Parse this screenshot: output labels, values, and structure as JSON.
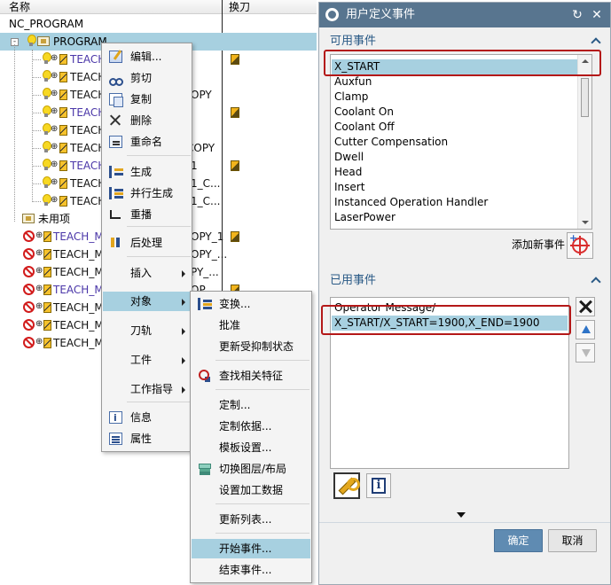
{
  "tree": {
    "headers": {
      "name": "名称",
      "tool_change": "换刀"
    },
    "root": "NC_PROGRAM",
    "program": "PROGRAM",
    "rows": [
      {
        "label": "TEACH",
        "suffix": "",
        "purple": true,
        "toolchange": true
      },
      {
        "label": "TEACH",
        "suffix": "",
        "purple": false,
        "toolchange": false
      },
      {
        "label": "TEACH",
        "suffix": "OPY",
        "purple": false,
        "toolchange": false
      },
      {
        "label": "TEACH",
        "suffix": "",
        "purple": true,
        "toolchange": true
      },
      {
        "label": "TEACH",
        "suffix": "",
        "purple": false,
        "toolchange": false
      },
      {
        "label": "TEACH",
        "suffix": "COPY",
        "purple": false,
        "toolchange": false
      },
      {
        "label": "TEACH",
        "suffix": "1",
        "purple": true,
        "toolchange": true
      },
      {
        "label": "TEACH",
        "suffix": "1_C...",
        "purple": false,
        "toolchange": false
      },
      {
        "label": "TEACH",
        "suffix": "1_C...",
        "purple": false,
        "toolchange": false
      }
    ],
    "unused_group": "未用项",
    "unused_rows": [
      {
        "label": "TEACH_M",
        "suffix": "OPY_1",
        "purple": true,
        "toolchange": true
      },
      {
        "label": "TEACH_M",
        "suffix": "OPY_...",
        "purple": false,
        "toolchange": false
      },
      {
        "label": "TEACH_M",
        "suffix": "PY_...",
        "purple": false,
        "toolchange": false
      },
      {
        "label": "TEACH_M",
        "suffix": "OP",
        "purple": true,
        "toolchange": true
      },
      {
        "label": "TEACH_M",
        "suffix": "",
        "purple": false,
        "toolchange": false
      },
      {
        "label": "TEACH_M",
        "suffix": "",
        "purple": false,
        "toolchange": false
      },
      {
        "label": "TEACH_M",
        "suffix": "",
        "purple": false,
        "toolchange": false
      }
    ]
  },
  "context_menu": {
    "items": [
      {
        "label": "编辑...",
        "icon": "edit-icon"
      },
      {
        "label": "剪切",
        "icon": "cut-icon"
      },
      {
        "label": "复制",
        "icon": "copy-icon"
      },
      {
        "label": "删除",
        "icon": "delete-icon"
      },
      {
        "label": "重命名",
        "icon": "rename-icon"
      },
      {
        "label": "生成",
        "icon": "generate-icon"
      },
      {
        "label": "并行生成",
        "icon": "parallel-generate-icon"
      },
      {
        "label": "重播",
        "icon": "replay-icon"
      },
      {
        "label": "后处理",
        "icon": "postprocess-icon"
      },
      {
        "label": "插入",
        "icon": ""
      },
      {
        "label": "对象",
        "icon": ""
      },
      {
        "label": "刀轨",
        "icon": ""
      },
      {
        "label": "工件",
        "icon": ""
      },
      {
        "label": "工作指导",
        "icon": ""
      },
      {
        "label": "信息",
        "icon": "info-icon"
      },
      {
        "label": "属性",
        "icon": "properties-icon"
      }
    ]
  },
  "sub_menu": {
    "items": [
      {
        "label": "变换...",
        "icon": "transform-icon"
      },
      {
        "label": "批准",
        "icon": ""
      },
      {
        "label": "更新受抑制状态",
        "icon": ""
      },
      {
        "label": "查找相关特征",
        "icon": "find-features-icon"
      },
      {
        "label": "定制...",
        "icon": ""
      },
      {
        "label": "定制依据...",
        "icon": ""
      },
      {
        "label": "模板设置...",
        "icon": ""
      },
      {
        "label": "切换图层/布局",
        "icon": "layer-icon"
      },
      {
        "label": "设置加工数据",
        "icon": ""
      },
      {
        "label": "更新列表...",
        "icon": ""
      },
      {
        "label": "开始事件...",
        "icon": ""
      },
      {
        "label": "结束事件...",
        "icon": ""
      }
    ]
  },
  "dialog": {
    "title": "用户定义事件",
    "available_section": "可用事件",
    "available_events": [
      "X_START",
      "Auxfun",
      "Clamp",
      "Coolant On",
      "Coolant Off",
      "Cutter Compensation",
      "Dwell",
      "Head",
      "Insert",
      "Instanced Operation Handler",
      "LaserPower"
    ],
    "add_event_label": "添加新事件",
    "used_section": "已用事件",
    "used_events": [
      "Operator Message/",
      "X_START/X_START=1900,X_END=1900"
    ],
    "ok": "确定",
    "cancel": "取消"
  },
  "colors": {
    "title_bar": "#58758f",
    "selection": "#a7d0e0",
    "annotation": "#b41818",
    "ok_button": "#5f8bb2"
  }
}
